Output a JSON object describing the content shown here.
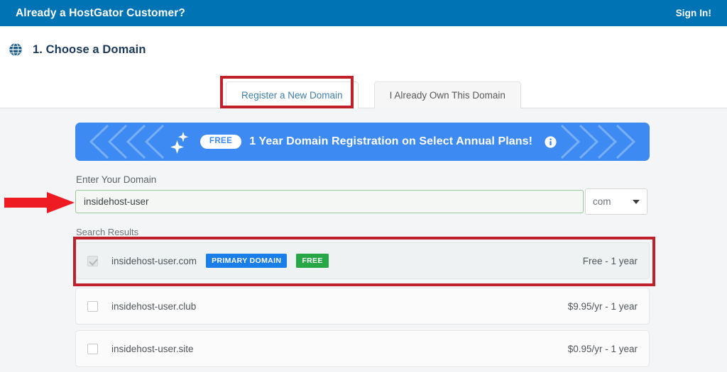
{
  "topbar": {
    "message": "Already a HostGator Customer?",
    "signin_label": "Sign In!",
    "background_color": "#0073b5"
  },
  "step_header": {
    "icon": "globe-icon",
    "title": "1. Choose a Domain"
  },
  "tabs": [
    {
      "label": "Register a New Domain",
      "active": true,
      "highlighted": true
    },
    {
      "label": "I Already Own This Domain",
      "active": false,
      "highlighted": false
    }
  ],
  "promo_banner": {
    "badge": "FREE",
    "text": "1 Year Domain Registration on Select Annual Plans!",
    "info_icon": "info-circle-icon",
    "sparkle_icon": "sparkle-icon",
    "background_color": "#3d8bf2"
  },
  "domain_form": {
    "label": "Enter Your Domain",
    "value": "insidehost-user",
    "placeholder": "Enter Your Domain",
    "tld_selected": "com",
    "tld_caret_icon": "chevron-down-icon",
    "border_color": "#9bc79b"
  },
  "search_results": {
    "label": "Search Results",
    "rows": [
      {
        "domain": "insidehost-user.com",
        "price": "Free - 1 year",
        "checked": true,
        "disabled": true,
        "badges": [
          {
            "text": "PRIMARY DOMAIN",
            "color": "#1a7ee8"
          },
          {
            "text": "FREE",
            "color": "#27a745"
          }
        ],
        "highlighted": true
      },
      {
        "domain": "insidehost-user.club",
        "price": "$9.95/yr - 1 year",
        "checked": false,
        "disabled": false,
        "badges": [],
        "highlighted": false
      },
      {
        "domain": "insidehost-user.site",
        "price": "$0.95/yr - 1 year",
        "checked": false,
        "disabled": false,
        "badges": [],
        "highlighted": false
      }
    ]
  },
  "annotations": {
    "arrow_color": "#ee1c22",
    "box_color": "#c0202a",
    "arrow_target": "domain-input",
    "box_targets": [
      "register-new-domain-tab",
      "primary-domain-result-row"
    ]
  }
}
